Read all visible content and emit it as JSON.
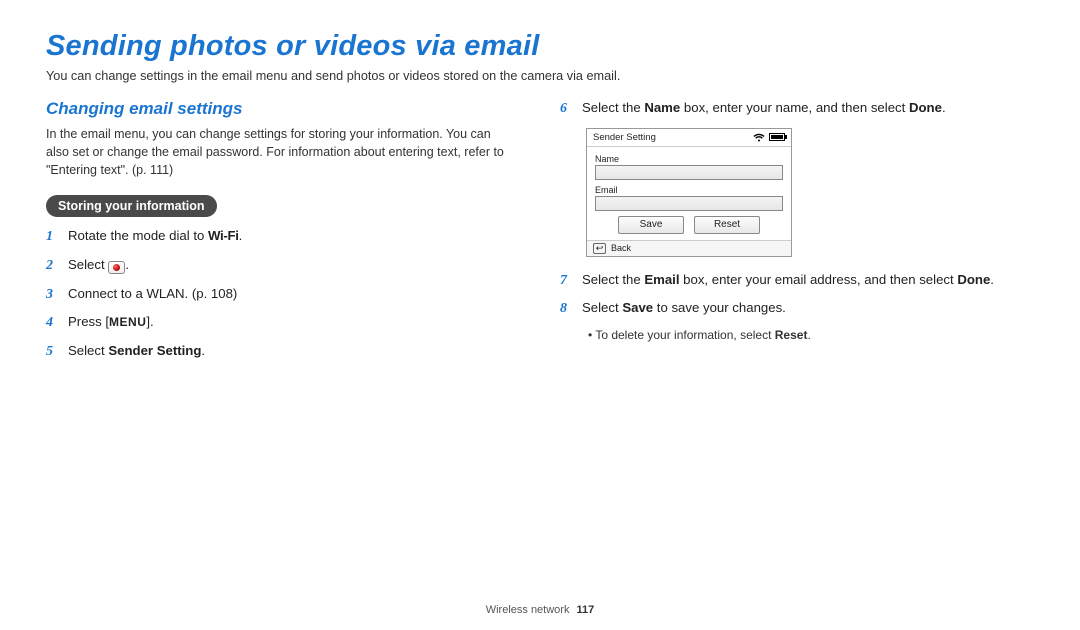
{
  "title": "Sending photos or videos via email",
  "intro": "You can change settings in the email menu and send photos or videos stored on the camera via email.",
  "section_heading": "Changing email settings",
  "section_para": "In the email menu, you can change settings for storing your information. You can also set or change the email password. For information about entering text, refer to \"Entering text\". (p. 111)",
  "pill_label": "Storing your information",
  "steps_left": {
    "s1_pre": "Rotate the mode dial to ",
    "s1_glyph": "Wi-Fi",
    "s1_post": ".",
    "s2_pre": "Select ",
    "s2_post": ".",
    "s3": "Connect to a WLAN. (p. 108)",
    "s4_pre": "Press [",
    "s4_glyph": "MENU",
    "s4_post": "].",
    "s5_pre": "Select ",
    "s5_bold": "Sender Setting",
    "s5_post": "."
  },
  "steps_right": {
    "s6_pre": "Select the ",
    "s6_b1": "Name",
    "s6_mid": " box, enter your name, and then select ",
    "s6_b2": "Done",
    "s6_post": ".",
    "s7_pre": "Select the ",
    "s7_b1": "Email",
    "s7_mid": " box, enter your email address, and then select ",
    "s7_b2": "Done",
    "s7_post": ".",
    "s8_pre": "Select ",
    "s8_b1": "Save",
    "s8_post": " to save your changes.",
    "note_pre": "To delete your information, select ",
    "note_b": "Reset",
    "note_post": "."
  },
  "device": {
    "title": "Sender Setting",
    "name_label": "Name",
    "email_label": "Email",
    "save": "Save",
    "reset": "Reset",
    "back": "Back"
  },
  "footer": {
    "section": "Wireless network",
    "page": "117"
  },
  "nums": {
    "n1": "1",
    "n2": "2",
    "n3": "3",
    "n4": "4",
    "n5": "5",
    "n6": "6",
    "n7": "7",
    "n8": "8"
  }
}
